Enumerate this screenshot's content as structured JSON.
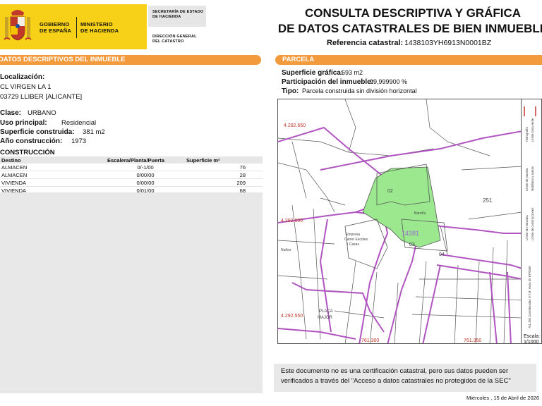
{
  "header": {
    "gobierno": [
      "GOBIERNO",
      "DE ESPAÑA"
    ],
    "ministerio": [
      "MINISTERIO",
      "DE HACIENDA"
    ],
    "secretaria": [
      "SECRETARÍA DE ESTADO",
      "DE HACIENDA"
    ],
    "direccion": [
      "DIRECCIÓN GENERAL",
      "DEL CATASTRO"
    ],
    "title_line1": "CONSULTA DESCRIPTIVA Y GRÁFICA",
    "title_line2": "DE DATOS CATASTRALES DE BIEN INMUEBLE",
    "ref_label": "Referencia catastral:",
    "ref_value": "1438103YH6913N0001BZ"
  },
  "left": {
    "bar_title": "DATOS DESCRIPTIVOS DEL INMUEBLE",
    "localizacion_label": "Localización:",
    "address_line1": "CL VIRGEN LA 1",
    "address_line2": "03729 LLIBER [ALICANTE]",
    "clase_label": "Clase:",
    "clase_value": "URBANO",
    "uso_label": "Uso principal:",
    "uso_value": "Residencial",
    "superficie_label": "Superficie construida:",
    "superficie_value": "381 m2",
    "anio_label": "Año construcción:",
    "anio_value": "1973",
    "construccion_title": "CONSTRUCCIÓN",
    "table_headers": [
      "Destino",
      "Escalera/Planta/Puerta",
      "Superficie m²"
    ],
    "rows": [
      [
        "ALMACEN",
        "0/-1/00",
        "76"
      ],
      [
        "ALMACEN",
        "0/00/00",
        "28"
      ],
      [
        "VIVIENDA",
        "0/00/00",
        "209"
      ],
      [
        "VIVIENDA",
        "0/01/00",
        "68"
      ]
    ]
  },
  "right": {
    "bar_title": "PARCELA",
    "sup_grafica_label": "Superficie gráfica:",
    "sup_grafica_value": "693 m2",
    "participacion_label": "Participación del inmueble:",
    "participacion_value": "99,999900 %",
    "tipo_label": "Tipo:",
    "tipo_value": "Parcela construida sin división horizontal"
  },
  "map": {
    "coord_top": "4.292.650",
    "coord_mid": "4.292.600",
    "coord_bottom": "4.292.550",
    "coord_x1": "761.300",
    "coord_x2": "761.350",
    "parcel_label": "14381",
    "labels": [
      "02",
      "251",
      "03",
      "04",
      "Baroña",
      "Empresa",
      "Carrer Escoles",
      "I Casas",
      "Nuñez",
      "PLAÇA",
      "MAJOR",
      "Escala:",
      "1/1000"
    ],
    "legend_items": [
      "Hidrografía",
      "Límite zona verde",
      "Mobiliario y aceras",
      "Límite de parcela",
      "Límite de construcciones",
      "Límite de manzana",
      "761.350 Coordenadas U.T.M. Huso 30 ETRS89"
    ],
    "parcel_color": "#9be88f",
    "boundary_color": "#b055c0"
  },
  "note": "Este documento no es una certificación catastral, pero sus datos pueden ser verificados a través del \"Acceso a datos catastrales no protegidos de la SEC\"",
  "date": "Miércoles , 15 de Abril de 2026",
  "colors": {
    "accent": "#f39a3c",
    "yellow": "#f7d117"
  }
}
